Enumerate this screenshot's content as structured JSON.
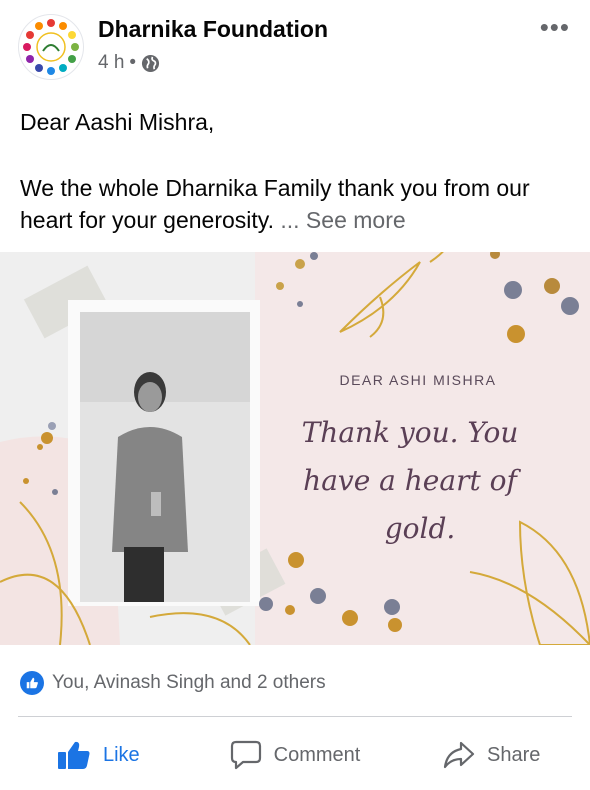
{
  "post": {
    "page_name": "Dharnika Foundation",
    "time": "4 h",
    "separator": "•",
    "audience_icon": "globe-icon",
    "more_icon": "more-options-icon",
    "greeting": "Dear Aashi Mishra,",
    "body": "We the whole Dharnika Family thank you from our heart for your generosity.",
    "see_more": "... See more"
  },
  "card": {
    "heading": "DEAR ASHI MISHRA",
    "script_line1": "Thank you. You",
    "script_line2": "have a heart of",
    "script_line3": "gold."
  },
  "reactions": {
    "icon": "like-reaction-icon",
    "summary": "You, Avinash Singh and 2 others"
  },
  "actions": {
    "like": "Like",
    "comment": "Comment",
    "share": "Share"
  },
  "colors": {
    "brand_blue": "#1b74e4",
    "secondary_text": "#65676b",
    "card_background": "#f3e6e6",
    "gold": "#d4a93a"
  }
}
